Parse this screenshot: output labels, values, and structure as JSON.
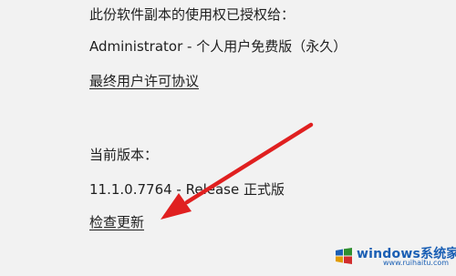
{
  "license": {
    "heading": "此份软件副本的使用权已授权给：",
    "holder": "Administrator - 个人用户免费版（永久）",
    "eula_link": "最终用户许可协议"
  },
  "version": {
    "heading": "当前版本：",
    "value": "11.1.0.7764 - Release 正式版",
    "check_update_link": "检查更新"
  },
  "annotation": {
    "arrow_color": "#e02020",
    "icon": "arrow-icon"
  },
  "watermark": {
    "brand": "windows系统家园",
    "url": "www.ruihaitu.com",
    "icon": "windows-logo-icon"
  }
}
